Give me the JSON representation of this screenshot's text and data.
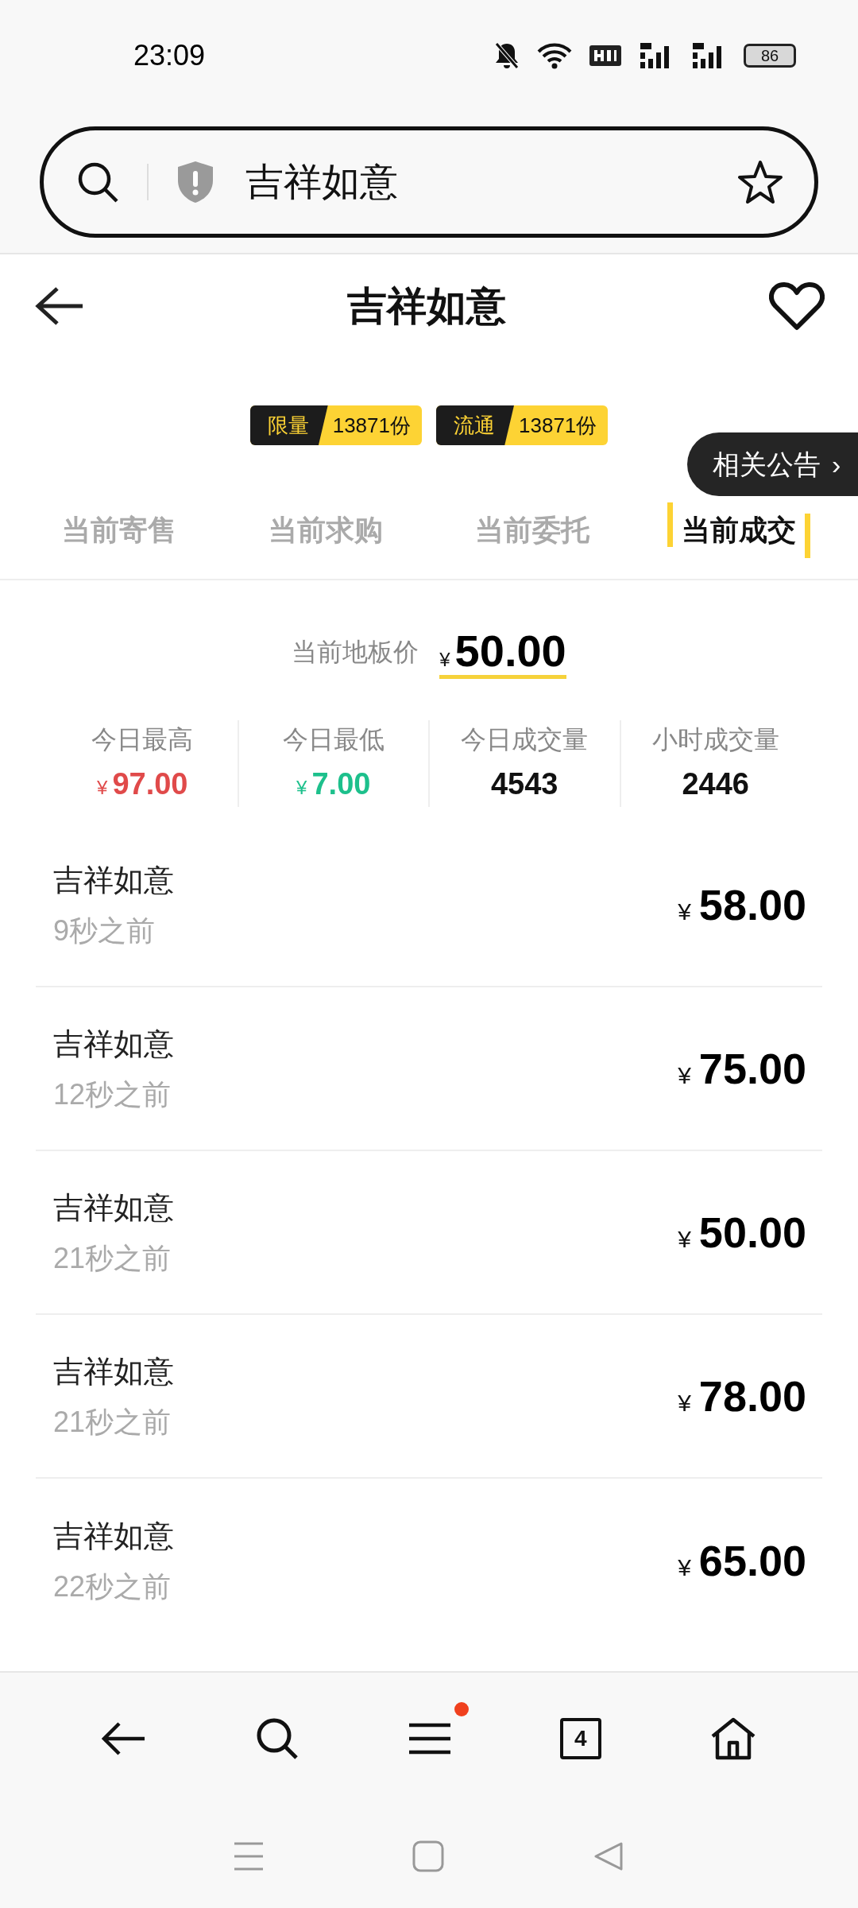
{
  "status_bar": {
    "time": "23:09",
    "battery": "86"
  },
  "address_bar": {
    "value": "吉祥如意"
  },
  "header": {
    "title": "吉祥如意",
    "badges": [
      {
        "label": "限量",
        "value": "13871份"
      },
      {
        "label": "流通",
        "value": "13871份"
      }
    ]
  },
  "notice_button": {
    "label": "相关公告",
    "arrow": "›"
  },
  "tabs": [
    {
      "label": "当前寄售",
      "selected": false
    },
    {
      "label": "当前求购",
      "selected": false
    },
    {
      "label": "当前委托",
      "selected": false
    },
    {
      "label": "当前成交",
      "selected": true
    }
  ],
  "floor_price": {
    "label": "当前地板价",
    "currency": "¥",
    "value": "50.00"
  },
  "stats": [
    {
      "label": "今日最高",
      "currency": "¥",
      "value": "97.00",
      "color": "#e04a4a"
    },
    {
      "label": "今日最低",
      "currency": "¥",
      "value": "7.00",
      "color": "#1dc08c"
    },
    {
      "label": "今日成交量",
      "value": "4543",
      "color": "#111111"
    },
    {
      "label": "小时成交量",
      "value": "2446",
      "color": "#111111"
    }
  ],
  "trades": [
    {
      "name": "吉祥如意",
      "time": "9秒之前",
      "currency": "¥",
      "price": "58.00"
    },
    {
      "name": "吉祥如意",
      "time": "12秒之前",
      "currency": "¥",
      "price": "75.00"
    },
    {
      "name": "吉祥如意",
      "time": "21秒之前",
      "currency": "¥",
      "price": "50.00"
    },
    {
      "name": "吉祥如意",
      "time": "21秒之前",
      "currency": "¥",
      "price": "78.00"
    },
    {
      "name": "吉祥如意",
      "time": "22秒之前",
      "currency": "¥",
      "price": "65.00"
    }
  ],
  "browser_nav": {
    "tab_count": "4",
    "menu_badge": true
  }
}
